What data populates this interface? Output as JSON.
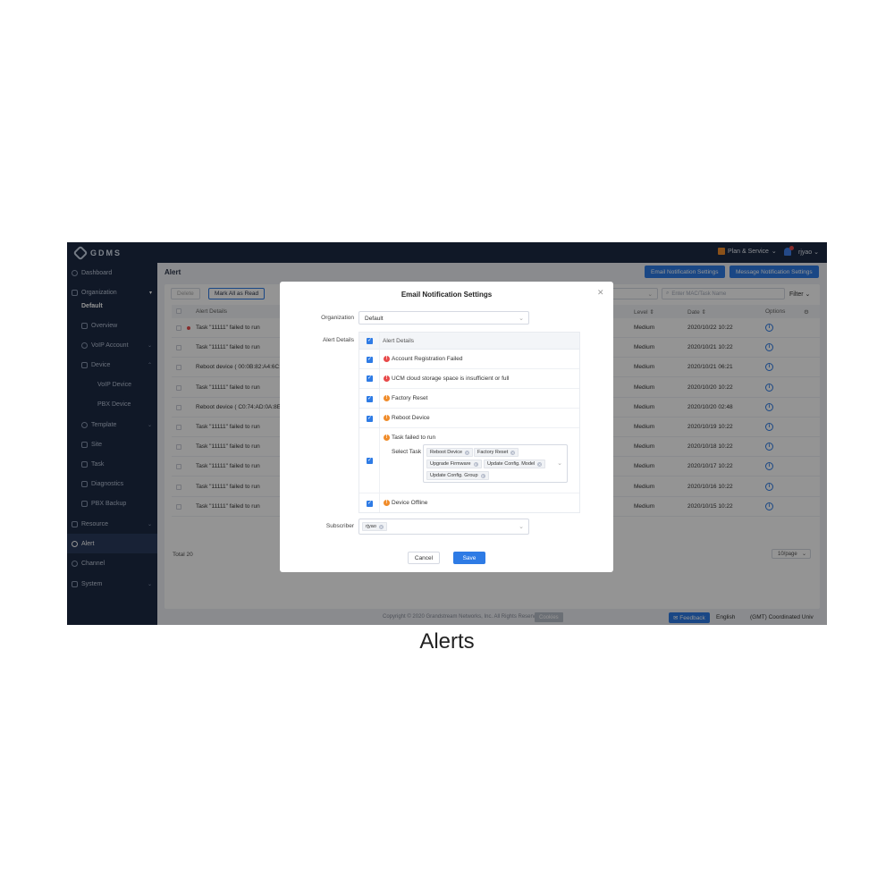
{
  "app": {
    "logo": "GDMS",
    "plan_label": "Plan & Service",
    "user": "rjyao"
  },
  "sidebar": {
    "dashboard": "Dashboard",
    "organization": "Organization",
    "org_default": "Default",
    "overview": "Overview",
    "voip_account": "VoIP Account",
    "device": "Device",
    "voip_device": "VoIP Device",
    "pbx_device": "PBX Device",
    "template": "Template",
    "site": "Site",
    "task": "Task",
    "diagnostics": "Diagnostics",
    "pbx_backup": "PBX Backup",
    "resource": "Resource",
    "alert": "Alert",
    "channel": "Channel",
    "system": "System"
  },
  "page": {
    "title": "Alert",
    "email_btn": "Email Notification Settings",
    "message_btn": "Message Notification Settings",
    "delete_btn": "Delete",
    "mark_read_btn": "Mark All as Read",
    "type_select_fragment": "ls",
    "search_placeholder": "Enter MAC/Task Name",
    "filter": "Filter",
    "columns": {
      "details": "Alert Details",
      "level": "Level",
      "date": "Date",
      "options": "Options"
    },
    "rows": [
      {
        "msg": "Task \"11111\" failed to run",
        "level": "Medium",
        "date": "2020/10/22 10:22",
        "unread": true
      },
      {
        "msg": "Task \"11111\" failed to run",
        "level": "Medium",
        "date": "2020/10/21 10:22",
        "unread": false
      },
      {
        "msg": "Reboot device ( 00:0B:82:A4:6C:4",
        "level": "Medium",
        "date": "2020/10/21 06:21",
        "unread": false
      },
      {
        "msg": "Task \"11111\" failed to run",
        "level": "Medium",
        "date": "2020/10/20 10:22",
        "unread": false
      },
      {
        "msg": "Reboot device ( C0:74:AD:0A:8E:9",
        "level": "Medium",
        "date": "2020/10/20 02:48",
        "unread": false
      },
      {
        "msg": "Task \"11111\" failed to run",
        "level": "Medium",
        "date": "2020/10/19 10:22",
        "unread": false
      },
      {
        "msg": "Task \"11111\" failed to run",
        "level": "Medium",
        "date": "2020/10/18 10:22",
        "unread": false
      },
      {
        "msg": "Task \"11111\" failed to run",
        "level": "Medium",
        "date": "2020/10/17 10:22",
        "unread": false
      },
      {
        "msg": "Task \"11111\" failed to run",
        "level": "Medium",
        "date": "2020/10/16 10:22",
        "unread": false
      },
      {
        "msg": "Task \"11111\" failed to run",
        "level": "Medium",
        "date": "2020/10/15 10:22",
        "unread": false
      }
    ],
    "total": "Total 20",
    "page_size": "10/page"
  },
  "footer": {
    "copyright": "Copyright © 2020 Grandstream Networks, Inc. All Rights Reserved.",
    "cookies": "Cookies",
    "feedback": "Feedback",
    "language": "English",
    "timezone": "(GMT) Coordinated Univ"
  },
  "modal": {
    "title": "Email Notification Settings",
    "organization_label": "Organization",
    "organization_value": "Default",
    "alert_details_label": "Alert Details",
    "table_header": "Alert Details",
    "items": [
      {
        "text": "Account Registration Failed",
        "severity": "high"
      },
      {
        "text": "UCM cloud storage space is insufficient or full",
        "severity": "high"
      },
      {
        "text": "Factory Reset",
        "severity": "medium"
      },
      {
        "text": "Reboot Device",
        "severity": "medium"
      },
      {
        "text": "Task failed to run",
        "severity": "medium"
      },
      {
        "text": "Device Offline",
        "severity": "medium"
      }
    ],
    "select_task_label": "Select Task",
    "task_tags": [
      "Reboot Device",
      "Factory Reset",
      "Upgrade Firmware",
      "Update Config. Model",
      "Update Config. Group"
    ],
    "subscriber_label": "Subscriber",
    "subscriber_tag": "rjyao",
    "cancel": "Cancel",
    "save": "Save"
  },
  "caption": "Alerts",
  "colors": {
    "sidebar": "#1c2a44",
    "accent": "#2e7be5",
    "high": "#e84a4a",
    "medium": "#f08c2b"
  }
}
